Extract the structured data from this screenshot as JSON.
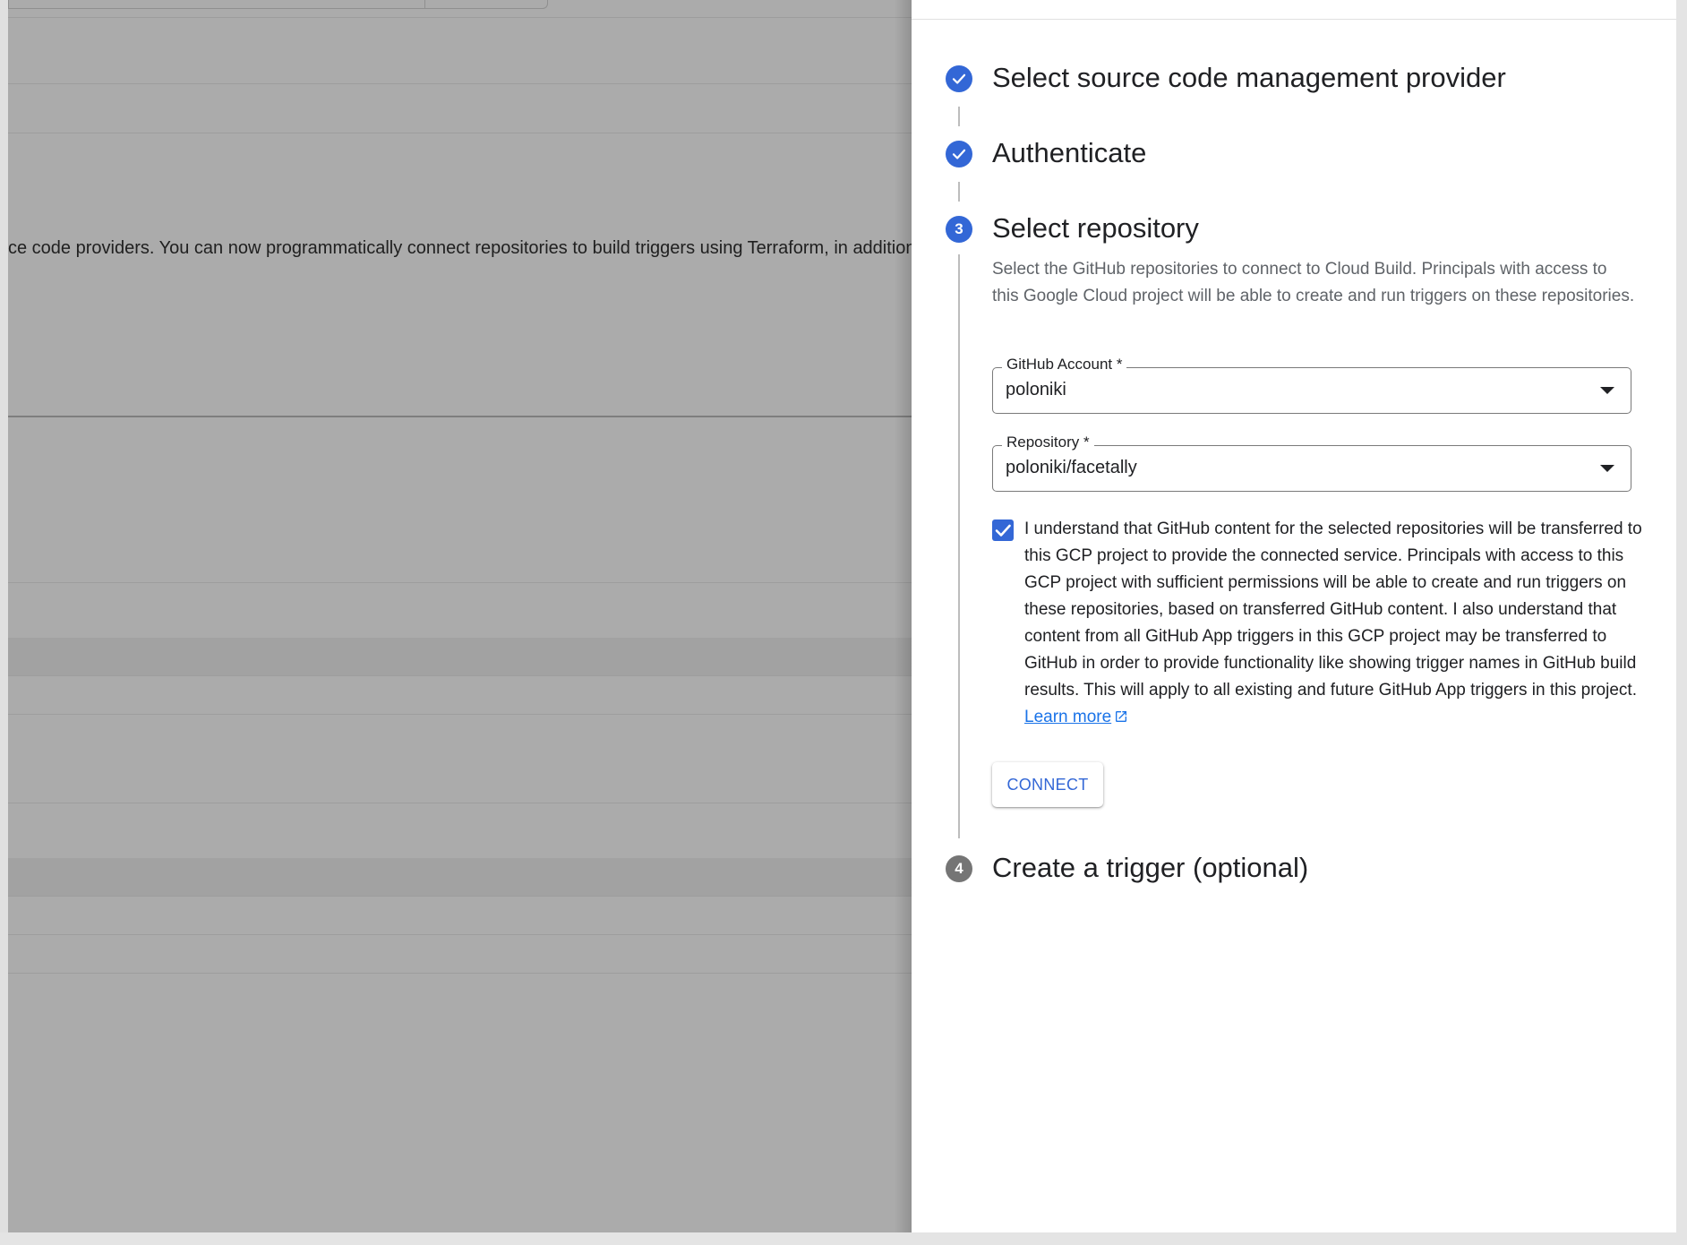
{
  "background": {
    "text": "ce code providers. You can now programmatically connect repositories to build triggers using Terraform, in addition to"
  },
  "steps": [
    {
      "number": "1",
      "title": "Select source code management provider",
      "state": "done"
    },
    {
      "number": "2",
      "title": "Authenticate",
      "state": "done"
    },
    {
      "number": "3",
      "title": "Select repository",
      "state": "active"
    },
    {
      "number": "4",
      "title": "Create a trigger (optional)",
      "state": "pending"
    }
  ],
  "select_repository": {
    "description": "Select the GitHub repositories to connect to Cloud Build. Principals with access to this Google Cloud project will be able to create and run triggers on these repositories.",
    "github_account": {
      "label": "GitHub Account *",
      "value": "poloniki"
    },
    "repository": {
      "label": "Repository *",
      "value": "poloniki/facetally"
    },
    "consent": {
      "checked": true,
      "text": "I understand that GitHub content for the selected repositories will be transferred to this GCP project to provide the connected service. Principals with access to this GCP project with sufficient permissions will be able to create and run triggers on these repositories, based on transferred GitHub content. I also understand that content from all GitHub App triggers in this GCP project may be transferred to GitHub in order to provide functionality like showing trigger names in GitHub build results. This will apply to all existing and future GitHub App triggers in this project.",
      "learn_more": "Learn more"
    },
    "connect_label": "CONNECT"
  },
  "icons": {
    "step_done": "check-circle-icon",
    "dropdown": "arrow-drop-down-icon",
    "checkbox": "check-icon",
    "external_link": "open-in-new-icon"
  },
  "colors": {
    "accent": "#3367d6",
    "link": "#1a73e8",
    "pending_step": "#757575",
    "overlay": "#ababab"
  }
}
